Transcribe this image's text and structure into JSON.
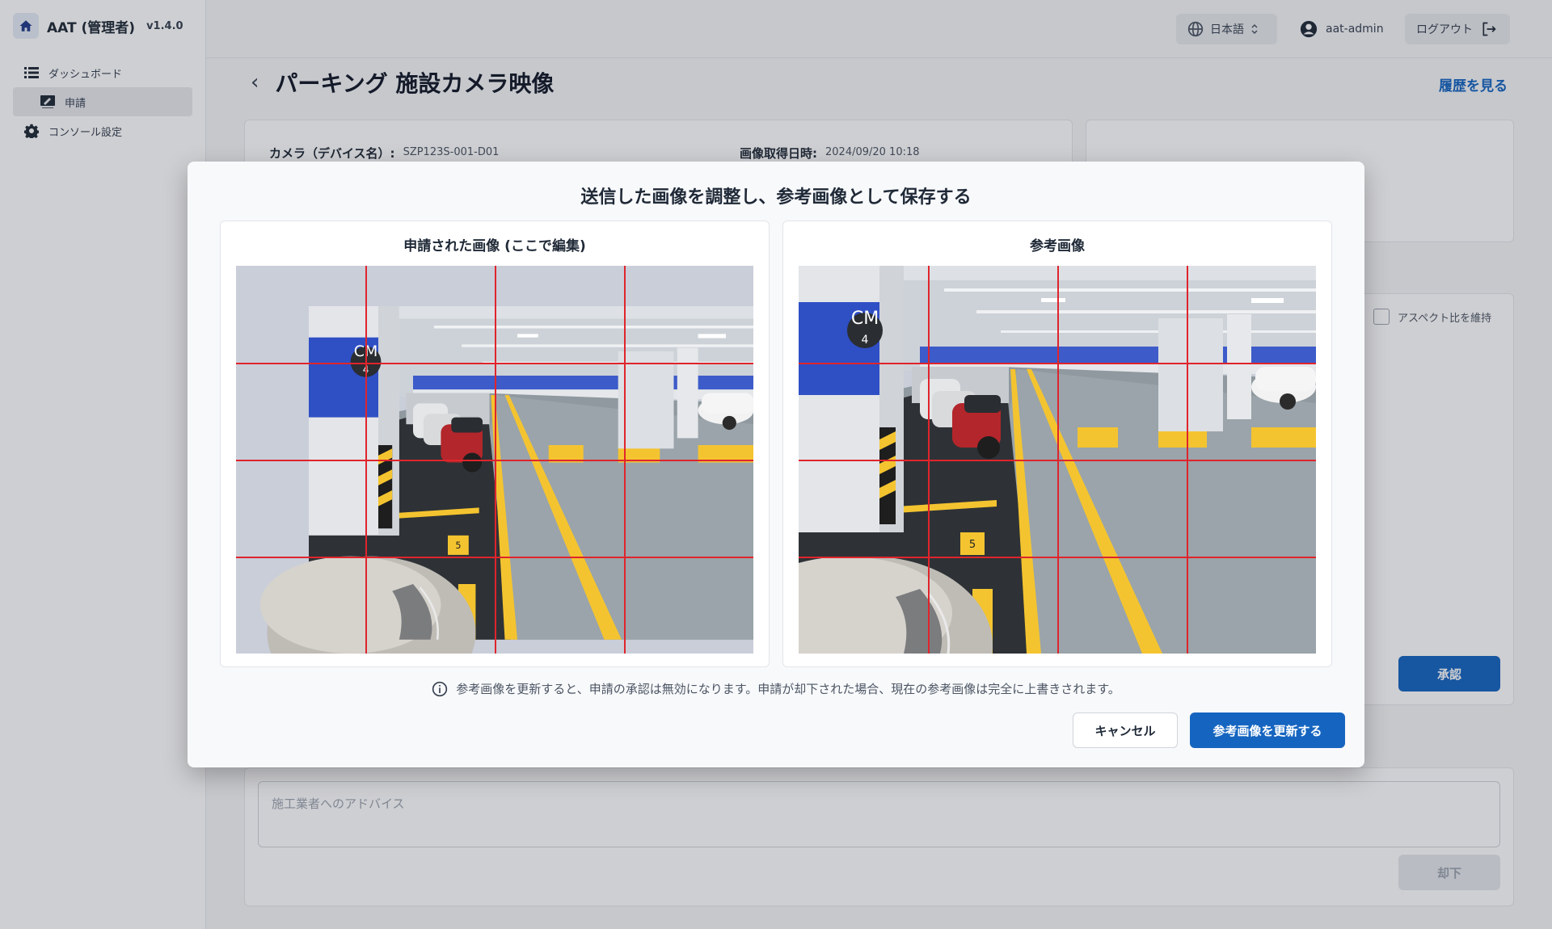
{
  "app": {
    "title": "AAT (管理者)",
    "version": "v1.4.0"
  },
  "sidebar": {
    "items": [
      {
        "label": "ダッシュボード",
        "icon": "list-icon"
      },
      {
        "label": "申請",
        "icon": "edit-icon",
        "active": true
      },
      {
        "label": "コンソール設定",
        "icon": "gear-icon"
      }
    ]
  },
  "header": {
    "language": "日本語",
    "user": "aat-admin",
    "logout": "ログアウト"
  },
  "page": {
    "title": "パーキング 施設カメラ映像",
    "history_link": "履歴を見る",
    "camera_label": "カメラ（デバイス名）:",
    "camera_value": "SZP123S-001-D01",
    "captured_label": "画像取得日時:",
    "captured_value": "2024/09/20 10:18",
    "aspect_label": "アスペクト比を維持",
    "approve_button": "承認",
    "advice_placeholder": "施工業者へのアドバイス",
    "reject_button": "却下"
  },
  "modal": {
    "title": "送信した画像を調整し、参考画像として保存する",
    "left_panel_title": "申請された画像 (ここで編集)",
    "right_panel_title": "参考画像",
    "note": "参考画像を更新すると、申請の承認は無効になります。申請が却下された場合、現在の参考画像は完全に上書きされます。",
    "cancel_button": "キャンセル",
    "update_button": "参考画像を更新する",
    "pillar_sign": "CM",
    "pillar_sign_number": "4",
    "floor_marking_number": "5"
  },
  "colors": {
    "primary": "#1565c0",
    "grid_line": "#e0242c",
    "pillar_blue": "#2f4fc4",
    "floor_yellow": "#f4c430"
  }
}
